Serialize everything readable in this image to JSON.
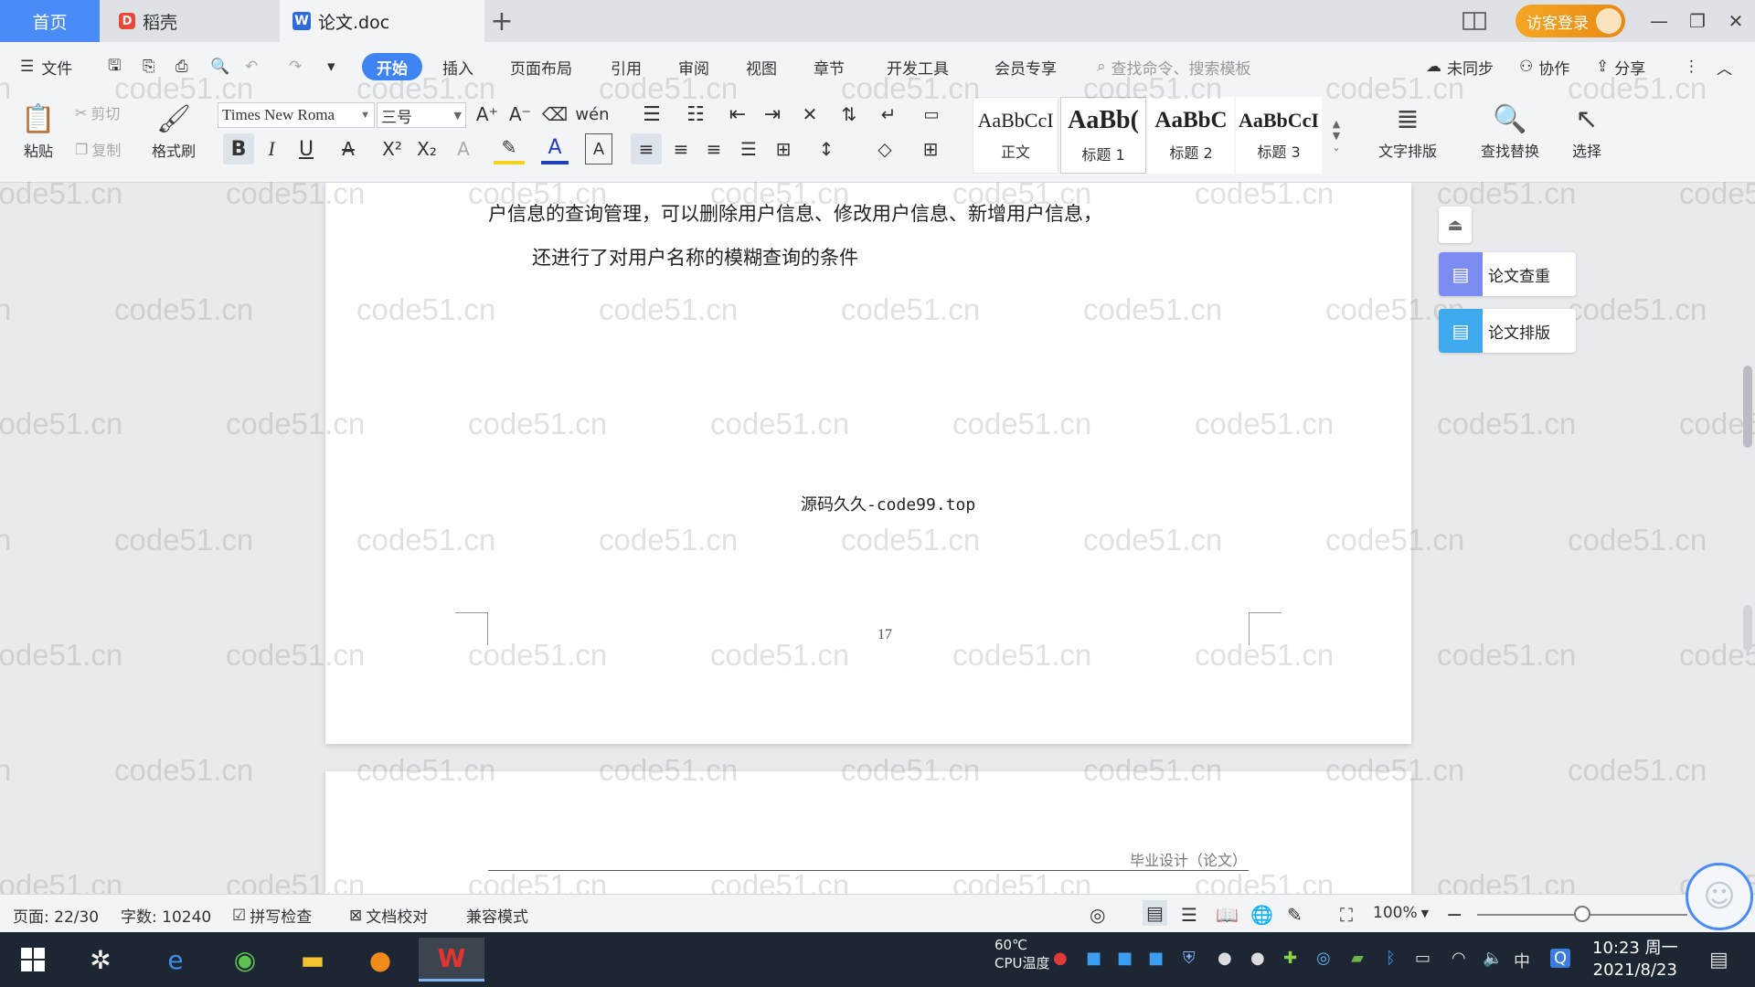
{
  "tabs": {
    "home": "首页",
    "daoke": "稻壳",
    "doc": "论文.doc",
    "new_tab": "+"
  },
  "window": {
    "login": "访客登录"
  },
  "menu": {
    "file": "文件",
    "items": [
      "开始",
      "插入",
      "页面布局",
      "引用",
      "审阅",
      "视图",
      "章节",
      "开发工具",
      "会员专享"
    ],
    "search_placeholder": "查找命令、搜索模板",
    "sync": "未同步",
    "collab": "协作",
    "share": "分享"
  },
  "ribbon": {
    "paste": "粘贴",
    "cut": "剪切",
    "copy": "复制",
    "format_painter": "格式刷",
    "font_name": "Times New Roma",
    "font_size": "三号",
    "styles": [
      {
        "preview": "AaBbCcI",
        "label": "正文"
      },
      {
        "preview": "AaBb(",
        "label": "标题 1"
      },
      {
        "preview": "AaBbC",
        "label": "标题 2"
      },
      {
        "preview": "AaBbCcI",
        "label": "标题 3"
      }
    ],
    "text_layout": "文字排版",
    "find_replace": "查找替换",
    "select": "选择"
  },
  "document": {
    "line1": "户信息的查询管理，可以删除用户信息、修改用户信息、新增用户信息，",
    "line2": "还进行了对用户名称的模糊查询的条件",
    "footer": "源码久久-code99.top",
    "page_number": "17",
    "next_page_header": "毕业设计（论文）",
    "watermark": "code51.cn"
  },
  "side_panel": {
    "check": "论文查重",
    "layout": "论文排版"
  },
  "status": {
    "page": "页面: 22/30",
    "words": "字数: 10240",
    "spell": "拼写检查",
    "proof": "文档校对",
    "compat": "兼容模式",
    "zoom": "100%"
  },
  "taskbar": {
    "cpu_temp": "60℃",
    "cpu_label": "CPU温度",
    "time": "10:23 周一",
    "date": "2021/8/23",
    "ime": "中"
  }
}
